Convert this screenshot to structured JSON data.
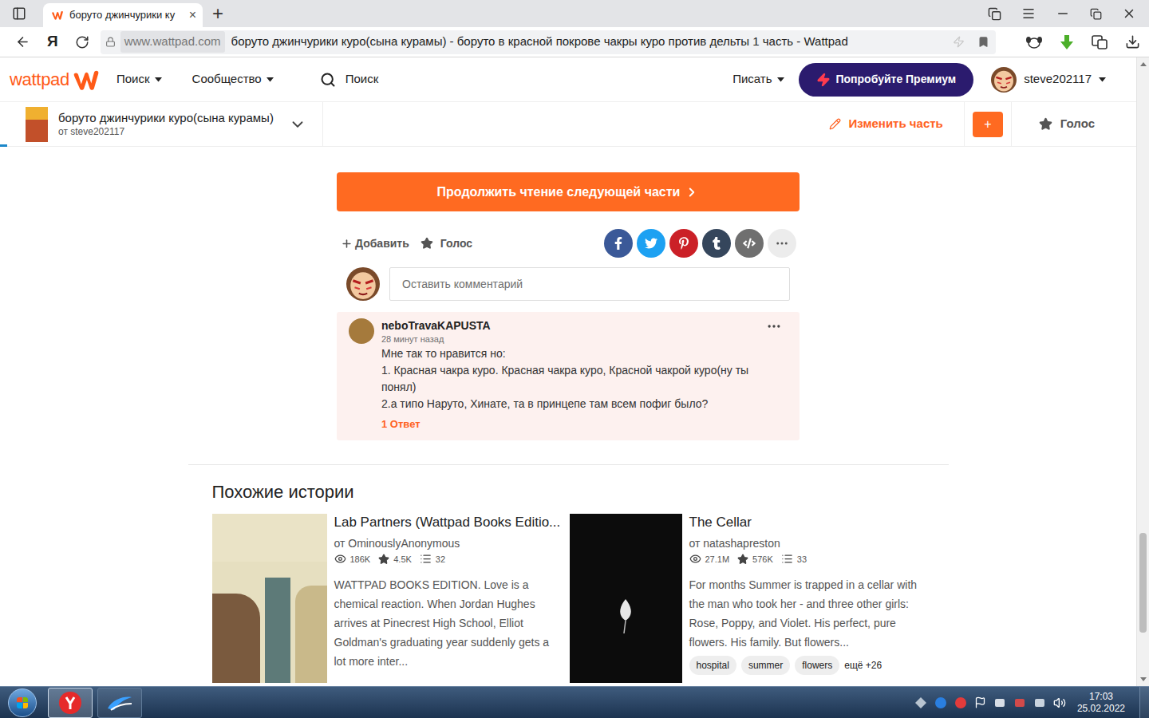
{
  "browser": {
    "tabs": [
      {
        "title": "боруто джинчурики ку",
        "close": "×",
        "selected": true
      }
    ],
    "new_tab": "+",
    "yandex_button": "Я",
    "address": {
      "domain": "www.wattpad.com",
      "title": "боруто джинчурики куро(сына курамы) - боруто в красной покрове чакры куро против дельты 1 часть - Wattpad"
    }
  },
  "header": {
    "logo": "wattpad",
    "nav": [
      "Поиск",
      "Сообщество"
    ],
    "search": "Поиск",
    "write": "Писать",
    "premium": "Попробуйте Премиум",
    "username": "steve202117"
  },
  "story_bar": {
    "title": "боруто джинчурики куро(сына курамы)",
    "author": "от steve202117",
    "edit": "Изменить часть",
    "add": "+",
    "vote": "Голос",
    "reading_progress": {
      "level": 0.006
    }
  },
  "continue_button": "Продолжить чтение следующей части",
  "actions": {
    "add": "Добавить",
    "vote": "Голос",
    "voted": false
  },
  "share": [
    {
      "kind": "facebook",
      "color": "#3b5998"
    },
    {
      "kind": "twitter",
      "color": "#1da1f2"
    },
    {
      "kind": "pinterest",
      "color": "#cb2027"
    },
    {
      "kind": "tumblr",
      "color": "#35465c"
    },
    {
      "kind": "embed",
      "color": "#6f6f6f"
    },
    {
      "kind": "more",
      "color": "#ececec"
    }
  ],
  "comment_box": {
    "placeholder": "Оставить комментарий"
  },
  "comments": [
    {
      "user": "neboTravaKAPUSTA",
      "time": "28 минут назад",
      "lines": [
        "Мне так то нравится но:",
        "1. Красная чакра куро. Красная чакра куро, Красной чакрой куро(ну ты понял)",
        "2.а типо Наруто, Хинате, та в принцепе там всем пофиг было?"
      ],
      "replies": "1 Ответ"
    }
  ],
  "similar": {
    "heading": "Похожие истории",
    "stories": [
      {
        "cover_kind": "light",
        "title": "Lab Partners (Wattpad Books Editio...",
        "author": "от OminouslyAnonymous",
        "views": "186K",
        "votes": "4.5K",
        "parts": "32",
        "description": "WATTPAD BOOKS EDITION. Love is a chemical reaction. When Jordan Hughes arrives at Pinecrest High School, Elliot Goldman's graduating year suddenly gets a lot more inter...",
        "tags": [],
        "more_tags": ""
      },
      {
        "cover_kind": "dark",
        "title": "The Cellar",
        "author": "от natashapreston",
        "views": "27.1M",
        "votes": "576K",
        "parts": "33",
        "description": "For months Summer is trapped in a cellar with the man who took her - and three other girls: Rose, Poppy, and Violet. His perfect, pure flowers. His family. But flowers...",
        "tags": [
          "hospital",
          "summer",
          "flowers"
        ],
        "more_tags": "ещё +26"
      }
    ]
  },
  "scrollbar": {
    "level": 0.92
  },
  "taskbar": {
    "apps": [
      {
        "kind": "yandex",
        "selected": true
      },
      {
        "kind": "app",
        "selected": false
      }
    ],
    "time": "17:03",
    "date": "25.02.2022"
  }
}
